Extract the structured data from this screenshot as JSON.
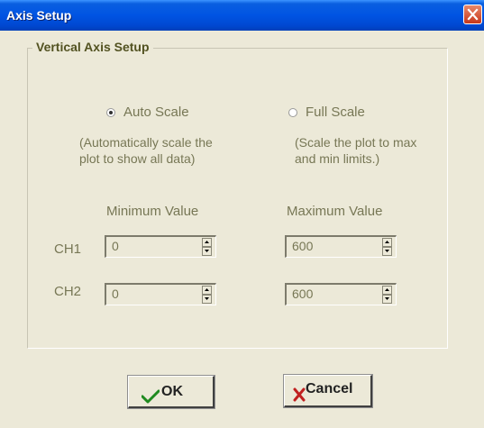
{
  "window": {
    "title": "Axis Setup"
  },
  "group": {
    "legend": "Vertical Axis Setup"
  },
  "auto_scale": {
    "label": "Auto Scale",
    "checked": true,
    "desc1": "(Automatically scale the",
    "desc2": "plot to show all data)"
  },
  "full_scale": {
    "label": "Full Scale",
    "checked": false,
    "desc1": "(Scale the plot to max",
    "desc2": "and min limits.)"
  },
  "headers": {
    "min": "Minimum Value",
    "max": "Maximum Value"
  },
  "channels": [
    {
      "label": "CH1",
      "min": "0",
      "max": "600"
    },
    {
      "label": "CH2",
      "min": "0",
      "max": "600"
    }
  ],
  "buttons": {
    "ok": "OK",
    "cancel": "Cancel"
  },
  "icons": {
    "close": "close-icon",
    "ok": "checkmark-icon",
    "cancel": "red-x-icon",
    "spin_up": "arrow-up-icon",
    "spin_down": "arrow-down-icon"
  },
  "colors": {
    "title_bar": "#0054e3",
    "face": "#ece9d8",
    "legend_text": "#525221",
    "label_text": "#777755",
    "close_button": "#c7371a",
    "ok_check": "#1f8a1f",
    "cancel_x": "#c02020"
  }
}
